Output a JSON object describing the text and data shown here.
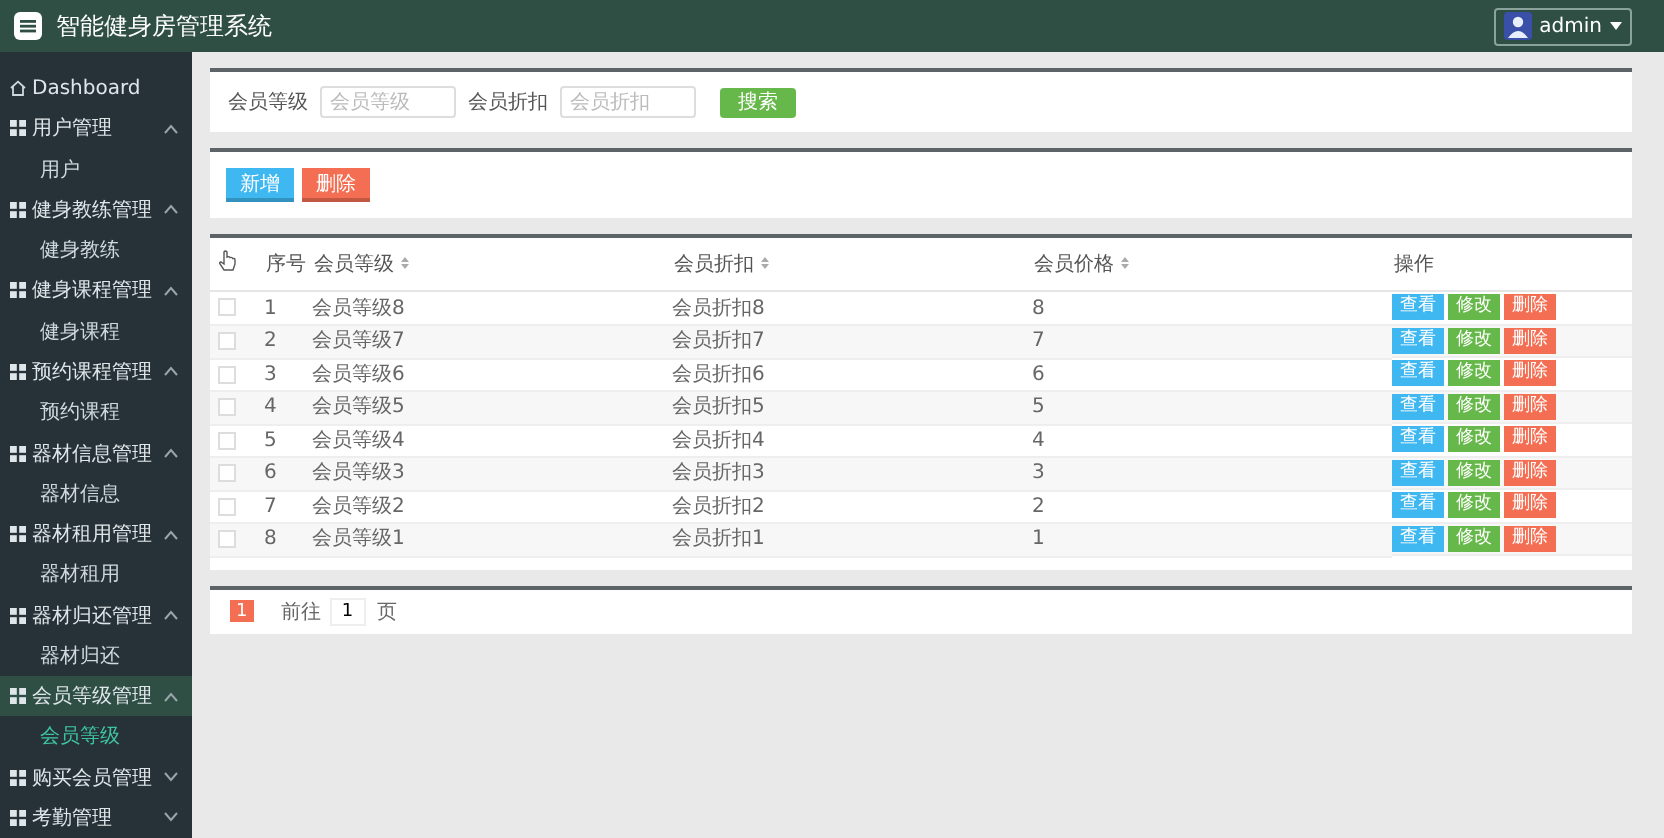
{
  "header": {
    "title": "智能健身房管理系统",
    "user": "admin"
  },
  "sidebar": {
    "items": [
      {
        "label": "Dashboard",
        "kind": "link",
        "selected": false
      },
      {
        "label": "用户管理",
        "kind": "group",
        "expanded": true,
        "selected": false,
        "children": [
          {
            "label": "用户",
            "selected": false
          }
        ]
      },
      {
        "label": "健身教练管理",
        "kind": "group",
        "expanded": true,
        "selected": false,
        "children": [
          {
            "label": "健身教练",
            "selected": false
          }
        ]
      },
      {
        "label": "健身课程管理",
        "kind": "group",
        "expanded": true,
        "selected": false,
        "children": [
          {
            "label": "健身课程",
            "selected": false
          }
        ]
      },
      {
        "label": "预约课程管理",
        "kind": "group",
        "expanded": true,
        "selected": false,
        "children": [
          {
            "label": "预约课程",
            "selected": false
          }
        ]
      },
      {
        "label": "器材信息管理",
        "kind": "group",
        "expanded": true,
        "selected": false,
        "children": [
          {
            "label": "器材信息",
            "selected": false
          }
        ]
      },
      {
        "label": "器材租用管理",
        "kind": "group",
        "expanded": true,
        "selected": false,
        "children": [
          {
            "label": "器材租用",
            "selected": false
          }
        ]
      },
      {
        "label": "器材归还管理",
        "kind": "group",
        "expanded": true,
        "selected": false,
        "children": [
          {
            "label": "器材归还",
            "selected": false
          }
        ]
      },
      {
        "label": "会员等级管理",
        "kind": "group",
        "expanded": true,
        "selected": true,
        "children": [
          {
            "label": "会员等级",
            "selected": true
          }
        ]
      },
      {
        "label": "购买会员管理",
        "kind": "group",
        "expanded": false,
        "selected": false
      },
      {
        "label": "考勤管理",
        "kind": "group",
        "expanded": false,
        "selected": false
      }
    ]
  },
  "search": {
    "fields": [
      {
        "label": "会员等级",
        "placeholder": "会员等级"
      },
      {
        "label": "会员折扣",
        "placeholder": "会员折扣"
      }
    ],
    "button": "搜索"
  },
  "actions": [
    {
      "label": "新增",
      "kind": "add"
    },
    {
      "label": "删除",
      "kind": "delete"
    }
  ],
  "table": {
    "columns": [
      {
        "label": "序号",
        "sortable": false
      },
      {
        "label": "会员等级",
        "sortable": true
      },
      {
        "label": "会员折扣",
        "sortable": true
      },
      {
        "label": "会员价格",
        "sortable": true
      },
      {
        "label": "操作",
        "sortable": false
      }
    ],
    "rows": [
      {
        "cells": [
          "1",
          "会员等级8",
          "会员折扣8",
          "8"
        ],
        "checked": false,
        "actions": [
          {
            "label": "查看",
            "kind": "view"
          },
          {
            "label": "修改",
            "kind": "edit"
          },
          {
            "label": "删除",
            "kind": "delete"
          }
        ]
      },
      {
        "cells": [
          "2",
          "会员等级7",
          "会员折扣7",
          "7"
        ],
        "checked": false,
        "actions": [
          {
            "label": "查看",
            "kind": "view"
          },
          {
            "label": "修改",
            "kind": "edit"
          },
          {
            "label": "删除",
            "kind": "delete"
          }
        ]
      },
      {
        "cells": [
          "3",
          "会员等级6",
          "会员折扣6",
          "6"
        ],
        "checked": false,
        "actions": [
          {
            "label": "查看",
            "kind": "view"
          },
          {
            "label": "修改",
            "kind": "edit"
          },
          {
            "label": "删除",
            "kind": "delete"
          }
        ]
      },
      {
        "cells": [
          "4",
          "会员等级5",
          "会员折扣5",
          "5"
        ],
        "checked": false,
        "actions": [
          {
            "label": "查看",
            "kind": "view"
          },
          {
            "label": "修改",
            "kind": "edit"
          },
          {
            "label": "删除",
            "kind": "delete"
          }
        ]
      },
      {
        "cells": [
          "5",
          "会员等级4",
          "会员折扣4",
          "4"
        ],
        "checked": false,
        "actions": [
          {
            "label": "查看",
            "kind": "view"
          },
          {
            "label": "修改",
            "kind": "edit"
          },
          {
            "label": "删除",
            "kind": "delete"
          }
        ]
      },
      {
        "cells": [
          "6",
          "会员等级3",
          "会员折扣3",
          "3"
        ],
        "checked": false,
        "actions": [
          {
            "label": "查看",
            "kind": "view"
          },
          {
            "label": "修改",
            "kind": "edit"
          },
          {
            "label": "删除",
            "kind": "delete"
          }
        ]
      },
      {
        "cells": [
          "7",
          "会员等级2",
          "会员折扣2",
          "2"
        ],
        "checked": false,
        "actions": [
          {
            "label": "查看",
            "kind": "view"
          },
          {
            "label": "修改",
            "kind": "edit"
          },
          {
            "label": "删除",
            "kind": "delete"
          }
        ]
      },
      {
        "cells": [
          "8",
          "会员等级1",
          "会员折扣1",
          "1"
        ],
        "checked": false,
        "actions": [
          {
            "label": "查看",
            "kind": "view"
          },
          {
            "label": "修改",
            "kind": "edit"
          },
          {
            "label": "删除",
            "kind": "delete"
          }
        ]
      }
    ]
  },
  "pagination": {
    "pages": [
      {
        "label": "1",
        "selected": true
      }
    ],
    "goto_label": "前往",
    "goto_value": "1",
    "page_suffix": "页"
  }
}
